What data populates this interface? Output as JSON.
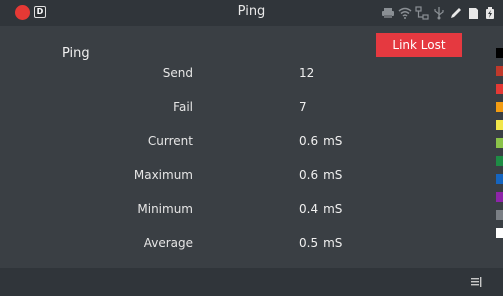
{
  "statusbar": {
    "title": "Ping",
    "badge": "D",
    "icons": [
      "printer-icon",
      "wifi-icon",
      "network-icon",
      "usb-icon",
      "pen-icon",
      "sd-card-icon",
      "battery-icon"
    ]
  },
  "main": {
    "section_title": "Ping",
    "link_status": "Link Lost",
    "rows": [
      {
        "label": "Send",
        "value": "12",
        "unit": ""
      },
      {
        "label": "Fail",
        "value": "7",
        "unit": ""
      },
      {
        "label": "Current",
        "value": "0.6",
        "unit": "mS"
      },
      {
        "label": "Maximum",
        "value": "0.6",
        "unit": "mS"
      },
      {
        "label": "Minimum",
        "value": "0.4",
        "unit": "mS"
      },
      {
        "label": "Average",
        "value": "0.5",
        "unit": "mS"
      }
    ]
  },
  "palette": [
    "#000000",
    "#c0392b",
    "#e53935",
    "#f39c12",
    "#f1e64a",
    "#8bc34a",
    "#1e8c45",
    "#1565c0",
    "#8e24aa",
    "#7a7f85",
    "#ffffff"
  ],
  "colors": {
    "background": "#3a3f44",
    "bars": "#30353a",
    "alert": "#e53940",
    "record": "#e53935"
  }
}
